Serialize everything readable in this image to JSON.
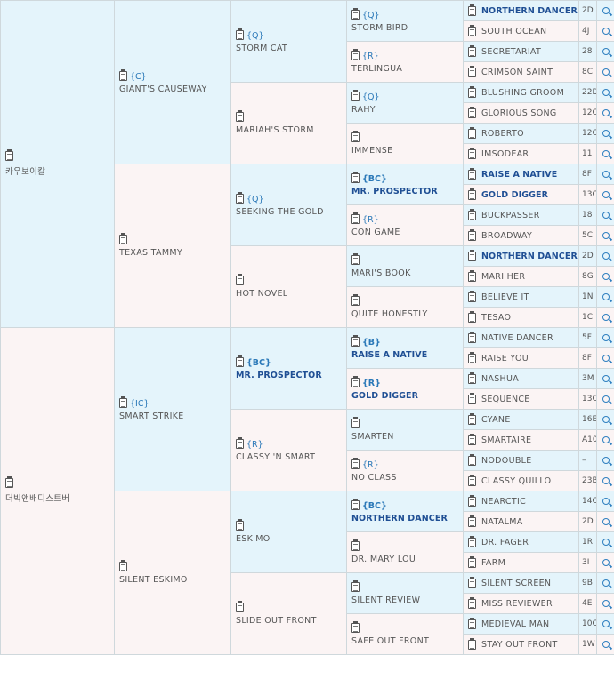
{
  "g0": [
    {
      "name": "카우보이칼",
      "code": ""
    },
    {
      "name": "더빅앤배디스트버",
      "code": ""
    }
  ],
  "g1": [
    {
      "name": "GIANT'S CAUSEWAY",
      "code": "{C}",
      "bold": false
    },
    {
      "name": "TEXAS TAMMY",
      "code": "",
      "bold": false
    },
    {
      "name": "SMART STRIKE",
      "code": "{IC}",
      "bold": false
    },
    {
      "name": "SILENT ESKIMO",
      "code": "",
      "bold": false
    }
  ],
  "g2": [
    {
      "name": "STORM CAT",
      "code": "{Q}",
      "bold": false
    },
    {
      "name": "MARIAH'S STORM",
      "code": "",
      "bold": false
    },
    {
      "name": "SEEKING THE GOLD",
      "code": "{Q}",
      "bold": false
    },
    {
      "name": "HOT NOVEL",
      "code": "",
      "bold": false
    },
    {
      "name": "MR. PROSPECTOR",
      "code": "{BC}",
      "bold": true
    },
    {
      "name": "CLASSY 'N SMART",
      "code": "{R}",
      "bold": false
    },
    {
      "name": "ESKIMO",
      "code": "",
      "bold": false
    },
    {
      "name": "SLIDE OUT FRONT",
      "code": "",
      "bold": false
    }
  ],
  "g3": [
    {
      "name": "STORM BIRD",
      "code": "{Q}",
      "bold": false
    },
    {
      "name": "TERLINGUA",
      "code": "{R}",
      "bold": false
    },
    {
      "name": "RAHY",
      "code": "{Q}",
      "bold": false
    },
    {
      "name": "IMMENSE",
      "code": "",
      "bold": false
    },
    {
      "name": "MR. PROSPECTOR",
      "code": "{BC}",
      "bold": true
    },
    {
      "name": "CON GAME",
      "code": "{R}",
      "bold": false
    },
    {
      "name": "MARI'S BOOK",
      "code": "",
      "bold": false
    },
    {
      "name": "QUITE HONESTLY",
      "code": "",
      "bold": false
    },
    {
      "name": "RAISE A NATIVE",
      "code": "{B}",
      "bold": true
    },
    {
      "name": "GOLD DIGGER",
      "code": "{R}",
      "bold": true
    },
    {
      "name": "SMARTEN",
      "code": "",
      "bold": false
    },
    {
      "name": "NO CLASS",
      "code": "{R}",
      "bold": false
    },
    {
      "name": "NORTHERN DANCER",
      "code": "{BC}",
      "bold": true
    },
    {
      "name": "DR. MARY LOU",
      "code": "",
      "bold": false
    },
    {
      "name": "SILENT REVIEW",
      "code": "",
      "bold": false
    },
    {
      "name": "SAFE OUT FRONT",
      "code": "",
      "bold": false
    }
  ],
  "g4": [
    {
      "name": "NORTHERN DANCER",
      "code": "2D",
      "bold": true
    },
    {
      "name": "SOUTH OCEAN",
      "code": "4J",
      "bold": false
    },
    {
      "name": "SECRETARIAT",
      "code": "28",
      "bold": false
    },
    {
      "name": "CRIMSON SAINT",
      "code": "8C",
      "bold": false
    },
    {
      "name": "BLUSHING GROOM",
      "code": "22D",
      "bold": false
    },
    {
      "name": "GLORIOUS SONG",
      "code": "12C",
      "bold": false
    },
    {
      "name": "ROBERTO",
      "code": "12C",
      "bold": false
    },
    {
      "name": "IMSODEAR",
      "code": "11",
      "bold": false
    },
    {
      "name": "RAISE A NATIVE",
      "code": "8F",
      "bold": true
    },
    {
      "name": "GOLD DIGGER",
      "code": "13C",
      "bold": true
    },
    {
      "name": "BUCKPASSER",
      "code": "18",
      "bold": false
    },
    {
      "name": "BROADWAY",
      "code": "5C",
      "bold": false
    },
    {
      "name": "NORTHERN DANCER",
      "code": "2D",
      "bold": true
    },
    {
      "name": "MARI HER",
      "code": "8G",
      "bold": false
    },
    {
      "name": "BELIEVE IT",
      "code": "1N",
      "bold": false
    },
    {
      "name": "TESAO",
      "code": "1C",
      "bold": false
    },
    {
      "name": "NATIVE DANCER",
      "code": "5F",
      "bold": false
    },
    {
      "name": "RAISE YOU",
      "code": "8F",
      "bold": false
    },
    {
      "name": "NASHUA",
      "code": "3M",
      "bold": false
    },
    {
      "name": "SEQUENCE",
      "code": "13C",
      "bold": false
    },
    {
      "name": "CYANE",
      "code": "16E",
      "bold": false
    },
    {
      "name": "SMARTAIRE",
      "code": "A10",
      "bold": false
    },
    {
      "name": "NODOUBLE",
      "code": "–",
      "bold": false
    },
    {
      "name": "CLASSY QUILLO",
      "code": "23B",
      "bold": false
    },
    {
      "name": "NEARCTIC",
      "code": "14C",
      "bold": false
    },
    {
      "name": "NATALMA",
      "code": "2D",
      "bold": false
    },
    {
      "name": "DR. FAGER",
      "code": "1R",
      "bold": false
    },
    {
      "name": "FARM",
      "code": "3I",
      "bold": false
    },
    {
      "name": "SILENT SCREEN",
      "code": "9B",
      "bold": false
    },
    {
      "name": "MISS REVIEWER",
      "code": "4E",
      "bold": false
    },
    {
      "name": "MEDIEVAL MAN",
      "code": "10C",
      "bold": false
    },
    {
      "name": "STAY OUT FRONT",
      "code": "1W",
      "bold": false
    }
  ],
  "colors": {
    "male_bg": "#e4f4fb",
    "female_bg": "#fbf4f4",
    "bold_name": "#1f4f94",
    "code": "#2a78b8",
    "border": "#cfd8dc"
  },
  "icons": {
    "pedigree": "clipboard-icon",
    "search": "magnifier-icon"
  }
}
